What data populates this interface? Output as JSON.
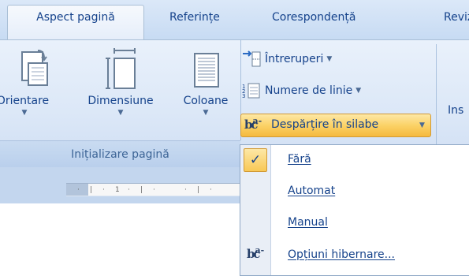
{
  "tabs": [
    {
      "label": "Aspect pagină",
      "active": true
    },
    {
      "label": "Referințe"
    },
    {
      "label": "Corespondență"
    },
    {
      "label": "Reviz"
    }
  ],
  "group": {
    "label": "Inițializare pagină",
    "buttons": {
      "orientation": "Orientare",
      "size": "Dimensiune",
      "columns": "Coloane"
    },
    "small_buttons": {
      "breaks": "Întreruperi",
      "line_numbers": "Numere de linie",
      "hyphenation": "Despărțire în silabe"
    }
  },
  "next_group": {
    "partial_label": "Ins"
  },
  "ruler": {
    "mark": "1"
  },
  "hyphen_menu": {
    "items": [
      {
        "label": "Fără",
        "checked": true
      },
      {
        "label": "Automat"
      },
      {
        "label": "Manual"
      },
      {
        "label": "Opțiuni hibernare..."
      }
    ]
  },
  "colors": {
    "ribbon_text": "#15428b",
    "highlight": "#fbd267",
    "ribbon_bg": "#dbe7f7"
  }
}
